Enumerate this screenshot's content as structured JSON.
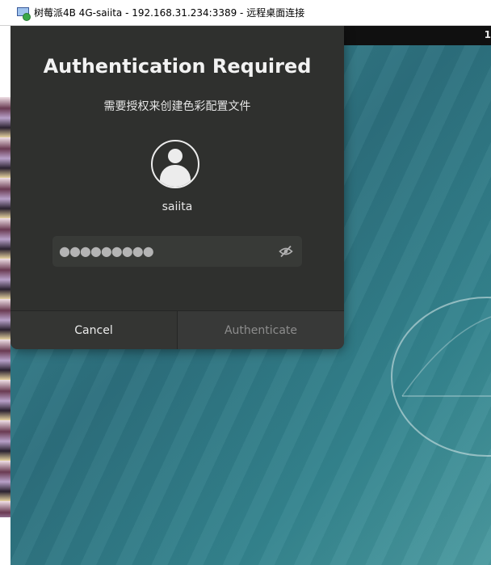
{
  "window": {
    "title": "树莓派4B 4G-saiita - 192.168.31.234:3389 - 远程桌面连接",
    "icon": "remote-desktop-icon"
  },
  "remote_topbar": {
    "clock_fragment": "1"
  },
  "dialog": {
    "title": "Authentication Required",
    "subtitle": "需要授权来创建色彩配置文件",
    "avatar_icon": "user-avatar-icon",
    "username": "saiita",
    "password": {
      "masked_value": "●●●●●●●●●",
      "reveal_icon": "eye-slash-icon"
    },
    "buttons": {
      "cancel": "Cancel",
      "authenticate": "Authenticate"
    }
  },
  "colors": {
    "dialog_bg": "#2f302e",
    "field_bg": "#383a37",
    "disabled_text": "#8d8d8d",
    "desktop_teal": "#2c6f7d"
  }
}
